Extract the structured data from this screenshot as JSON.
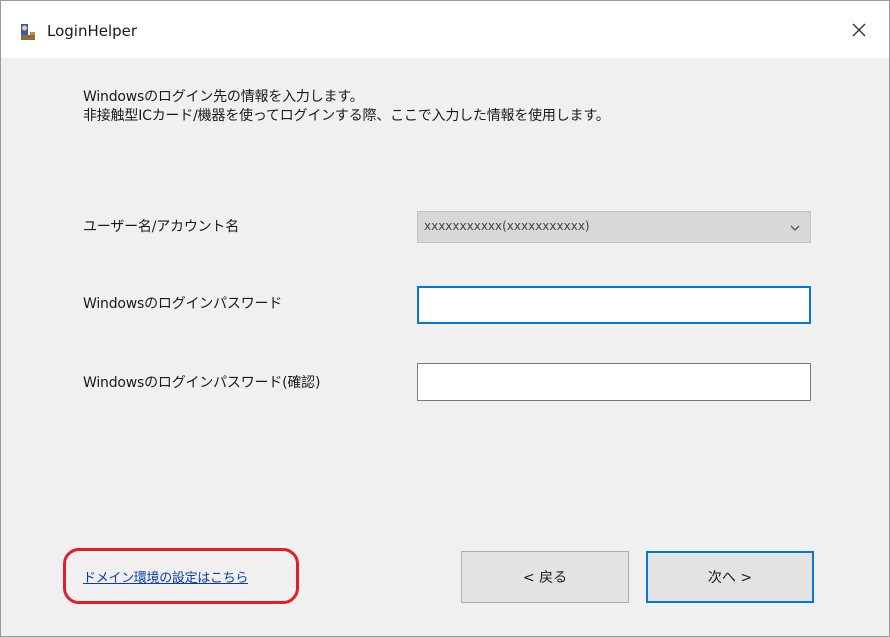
{
  "window": {
    "title": "LoginHelper",
    "close_icon": "close-icon",
    "app_icon": "user-login-icon"
  },
  "intro": {
    "line1": "Windowsのログイン先の情報を入力します。",
    "line2": "非接触型ICカード/機器を使ってログインする際、ここで入力した情報を使用します。"
  },
  "form": {
    "username_label": "ユーザー名/アカウント名",
    "username_value": "xxxxxxxxxxx(xxxxxxxxxxx)",
    "password_label": "Windowsのログインパスワード",
    "password_value": "",
    "confirm_label": "Windowsのログインパスワード(確認)",
    "confirm_value": ""
  },
  "footer": {
    "domain_link": "ドメイン環境の設定はこちら",
    "back_button": "< 戻る",
    "next_button": "次へ >"
  },
  "colors": {
    "focus_border": "#0078d7",
    "highlight_circle": "#e01e2c",
    "link": "#0a3ca6"
  }
}
